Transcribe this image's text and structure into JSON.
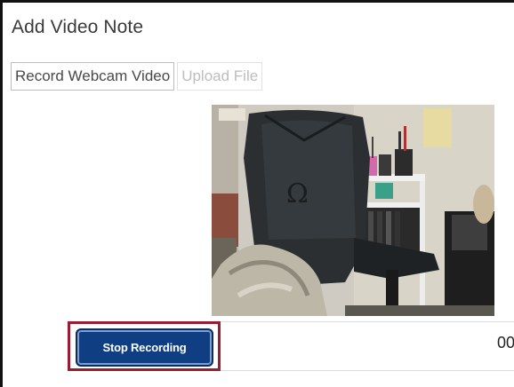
{
  "dialog": {
    "title": "Add Video Note"
  },
  "tabs": [
    {
      "label": "Record Webcam Video",
      "state": "active"
    },
    {
      "label": "Upload File",
      "state": "disabled"
    }
  ],
  "recorder": {
    "stop_label": "Stop Recording",
    "timer_text": "00",
    "recording": true
  },
  "colors": {
    "primary_button": "#0f3f82",
    "highlight_outline": "#9b1b30",
    "title_text": "#3a3a3a"
  }
}
